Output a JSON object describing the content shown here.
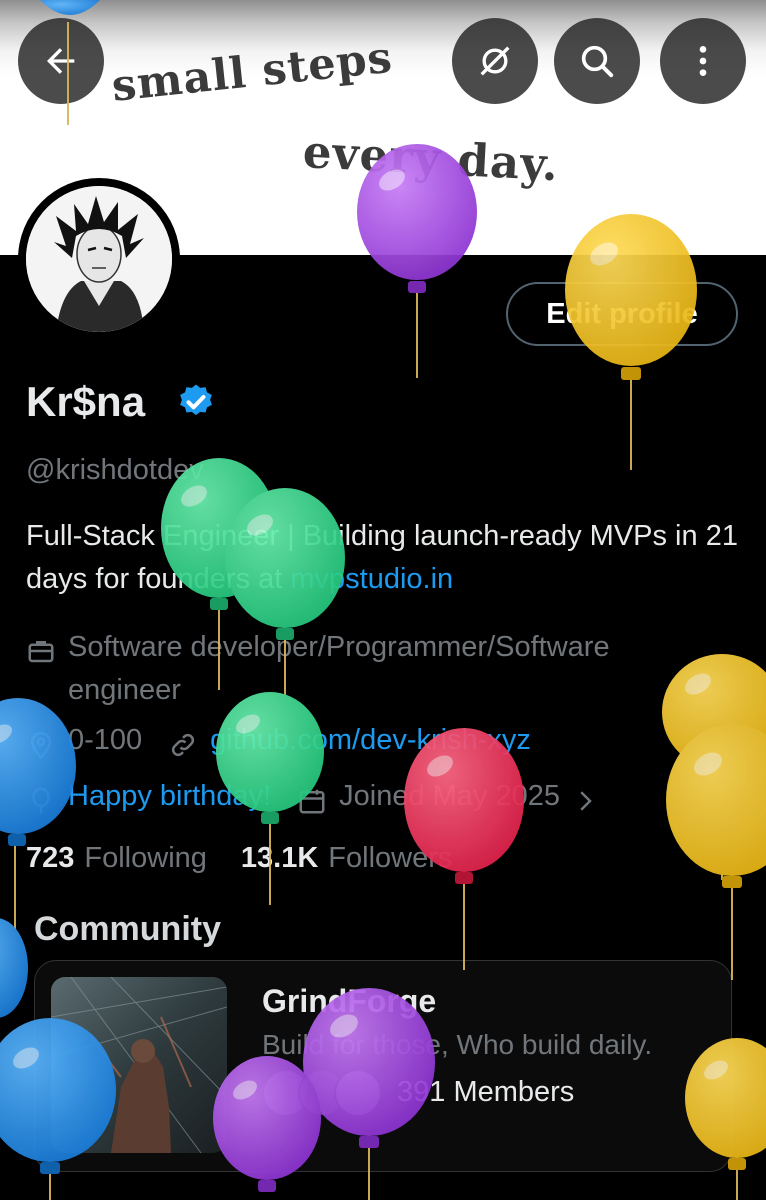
{
  "banner": {
    "line1": "small steps",
    "line2": "every day."
  },
  "header": {
    "back_icon": "arrow-left-icon",
    "mute_icon": "slash-circle-icon",
    "search_icon": "search-icon",
    "more_icon": "more-vertical-icon"
  },
  "profile": {
    "edit_label": "Edit profile",
    "display_name": "Kr$na",
    "handle": "@krishdotdev",
    "bio_text": "Full-Stack Engineer | Building launch-ready MVPs in 21 days for founders at ",
    "bio_link": "mvpstudio.in",
    "profession": "Software developer/Programmer/Software engineer",
    "location": "0-100",
    "website": "github.com/dev-krish-xyz",
    "birthday": "Happy birthday!",
    "joined": "Joined May 2025"
  },
  "stats": {
    "following_count": "723",
    "following_label": "Following",
    "followers_count": "13.1K",
    "followers_label": "Followers"
  },
  "community": {
    "title": "Community",
    "name": "GrindForge",
    "tagline": "Build for those, Who build daily.",
    "members": "391 Members"
  },
  "colors": {
    "accent": "#1d9bf0",
    "verified": "#1d9bf0",
    "balloon_purple": "#9b3fe0",
    "balloon_yellow": "#f2c21c",
    "balloon_green": "#2fd68a",
    "balloon_blue": "#1f8fe8",
    "balloon_red": "#f0315a"
  }
}
